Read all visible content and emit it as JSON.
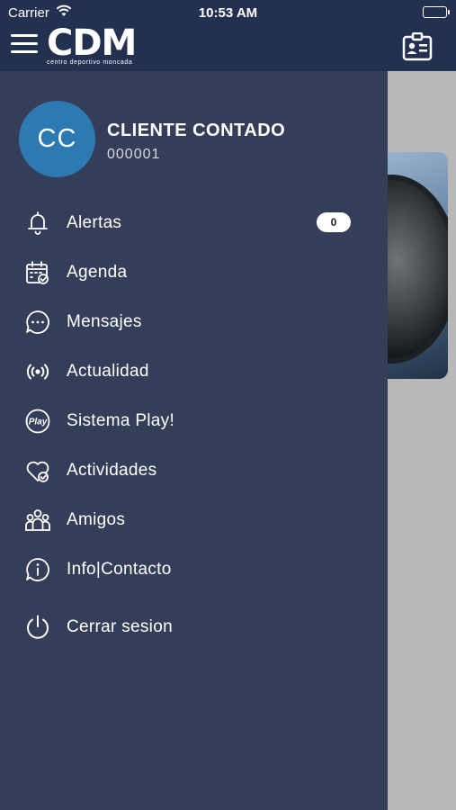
{
  "status_bar": {
    "carrier": "Carrier",
    "time": "10:53 AM"
  },
  "header": {
    "logo_text": "CDM",
    "logo_subtitle": "centro deportivo moncada"
  },
  "profile": {
    "initials": "CC",
    "name": "CLIENTE CONTADO",
    "id": "000001"
  },
  "menu": [
    {
      "label": "Alertas",
      "icon": "bell-icon",
      "badge": "0"
    },
    {
      "label": "Agenda",
      "icon": "calendar-check-icon"
    },
    {
      "label": "Mensajes",
      "icon": "chat-bubble-icon"
    },
    {
      "label": "Actualidad",
      "icon": "broadcast-icon"
    },
    {
      "label": "Sistema Play!",
      "icon": "play-logo-icon"
    },
    {
      "label": "Actividades",
      "icon": "heart-check-icon"
    },
    {
      "label": "Amigos",
      "icon": "group-icon"
    },
    {
      "label": "Info|Contacto",
      "icon": "info-bubble-icon"
    },
    {
      "label": "Cerrar sesion",
      "icon": "power-icon"
    }
  ],
  "colors": {
    "header": "#24304f",
    "drawer": "#353e58",
    "avatar": "#2d7ab2"
  }
}
